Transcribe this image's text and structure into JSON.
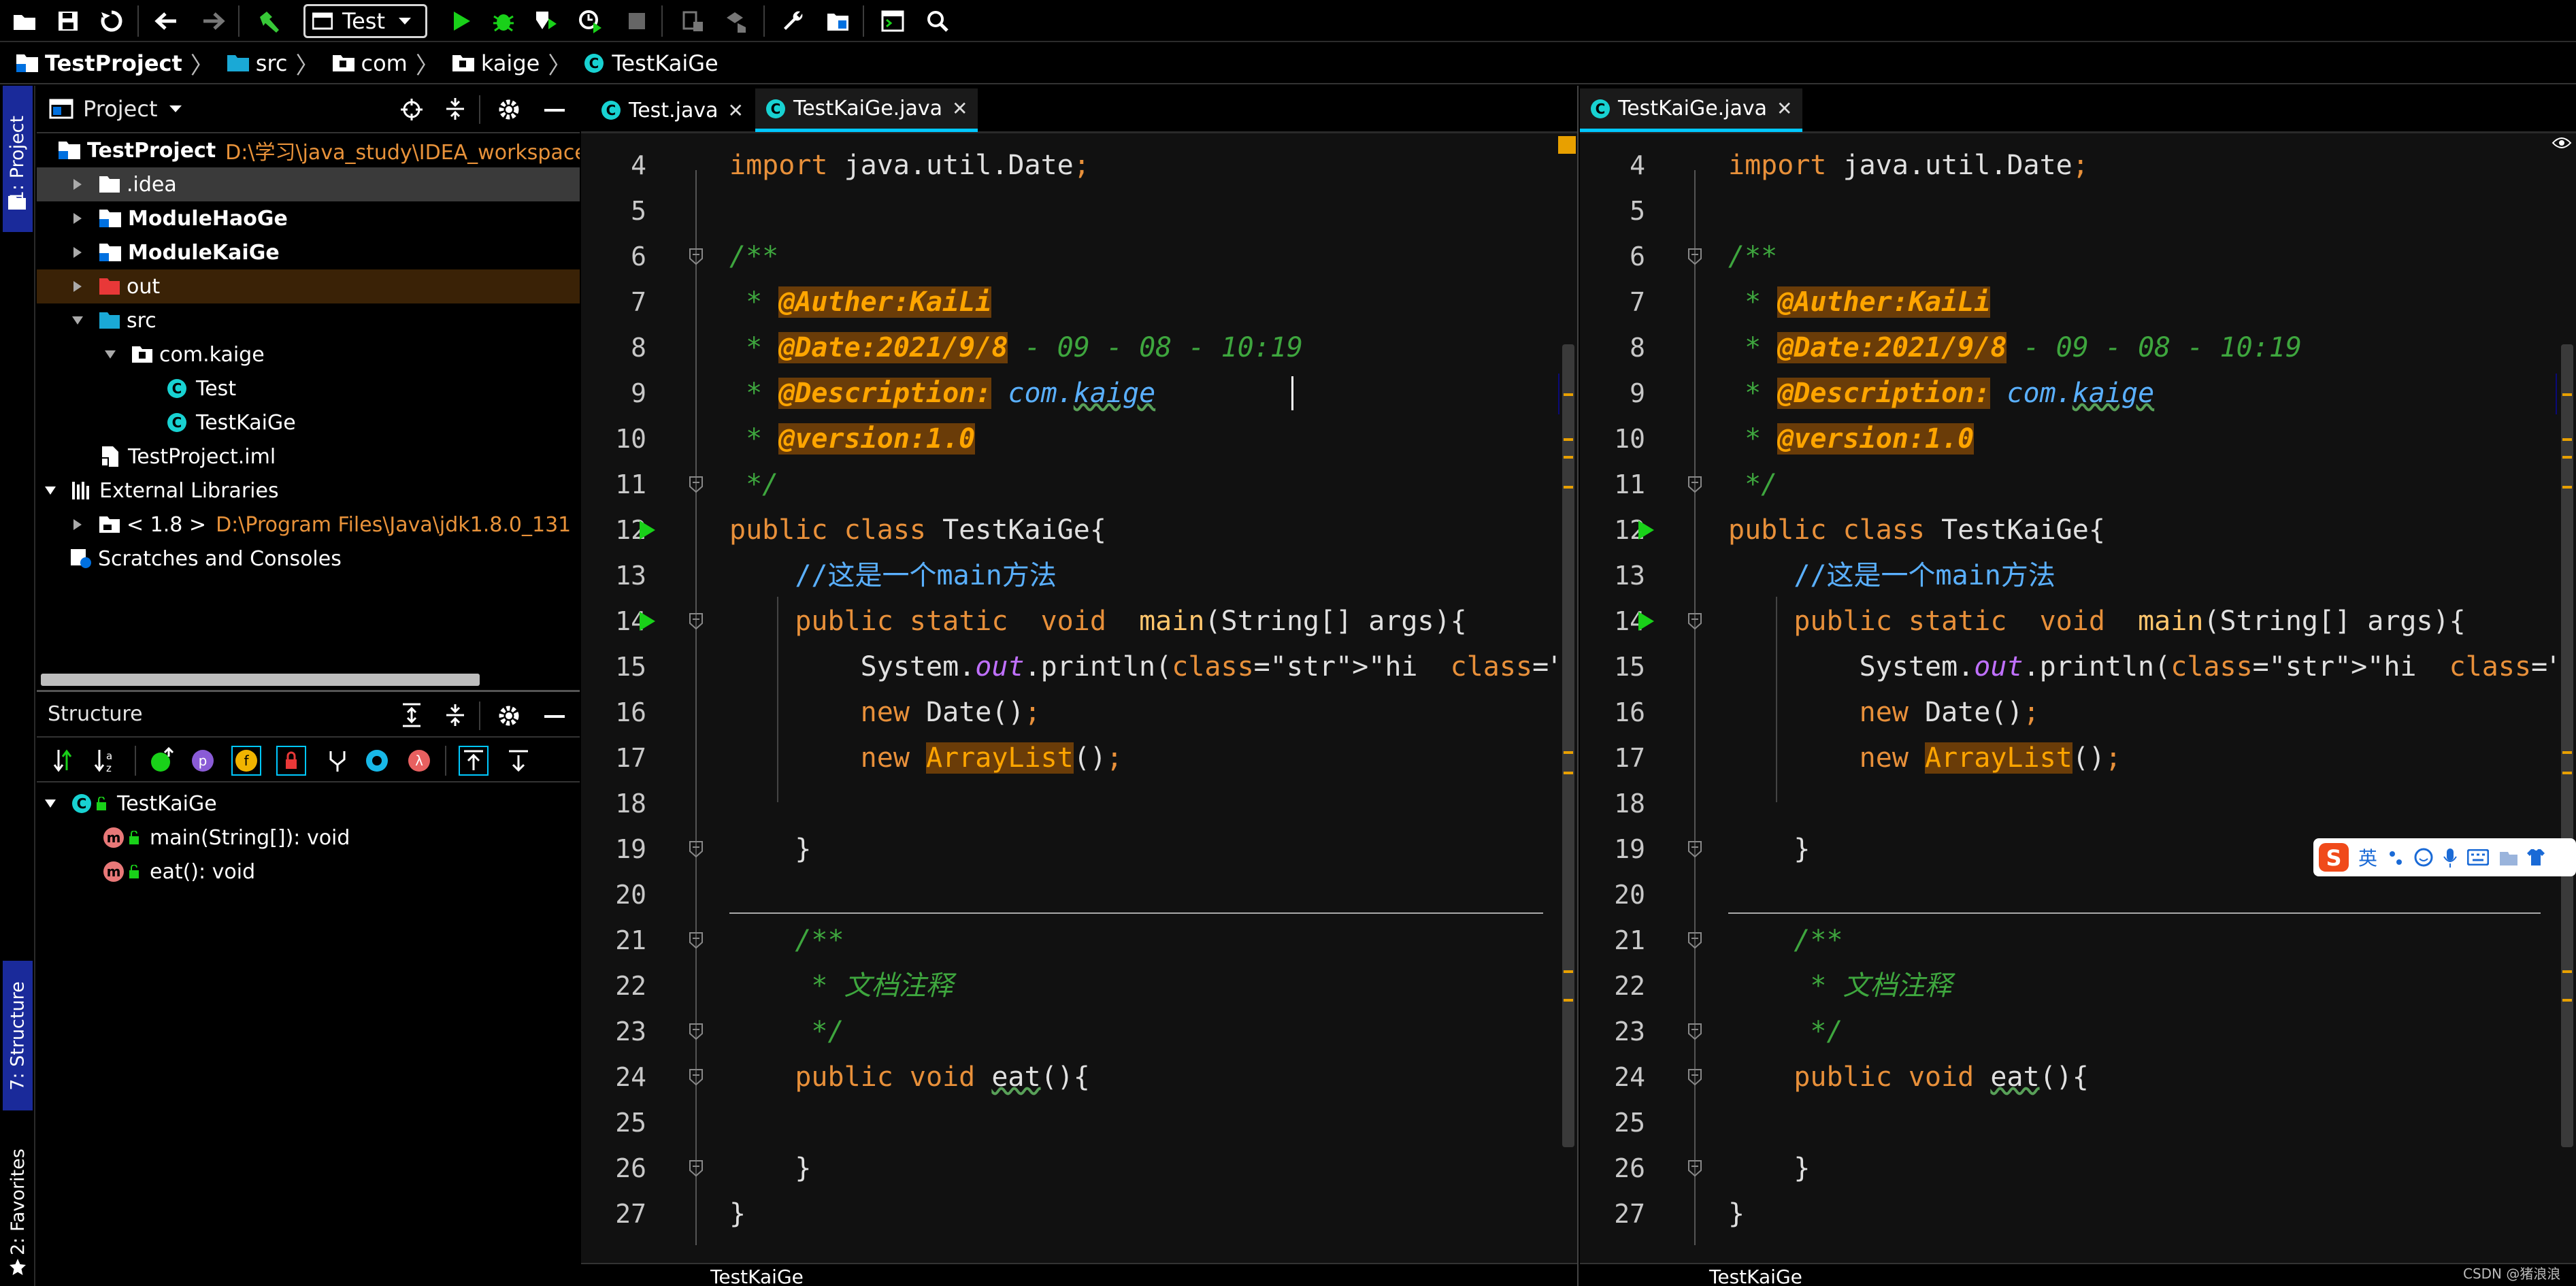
{
  "toolbar": {
    "run_config": "Test",
    "icons": [
      "open-folder-icon",
      "save-icon",
      "sync-icon",
      "back-icon",
      "forward-icon",
      "build-hammer-icon",
      "run-icon",
      "debug-icon",
      "coverage-icon",
      "profile-icon",
      "stop-icon",
      "deploy-icon",
      "deploy-all-icon",
      "settings-wrench-icon",
      "project-structure-icon",
      "terminal-icon",
      "search-icon"
    ]
  },
  "breadcrumb": [
    "TestProject",
    "src",
    "com",
    "kaige",
    "TestKaiGe"
  ],
  "stripe": {
    "project_tab": "1: Project",
    "structure_tab": "7: Structure",
    "favorites_tab": "2: Favorites"
  },
  "project_panel": {
    "title": "Project",
    "tree": [
      {
        "label": "TestProject",
        "path": "D:\\学习\\java_study\\IDEA_workspace\\",
        "bold": true
      },
      {
        "label": ".idea"
      },
      {
        "label": "ModuleHaoGe",
        "bold": true
      },
      {
        "label": "ModuleKaiGe",
        "bold": true
      },
      {
        "label": "out"
      },
      {
        "label": "src"
      },
      {
        "label": "com.kaige"
      },
      {
        "label": "Test"
      },
      {
        "label": "TestKaiGe"
      },
      {
        "label": "TestProject.iml"
      },
      {
        "label": "External Libraries"
      },
      {
        "label": "< 1.8 >",
        "path": "D:\\Program Files\\Java\\jdk1.8.0_131"
      },
      {
        "label": "Scratches and Consoles"
      }
    ]
  },
  "structure_panel": {
    "title": "Structure",
    "root": "TestKaiGe",
    "members": [
      "main(String[]): void",
      "eat(): void"
    ],
    "toolbar_badges": [
      "p",
      "f",
      "λ"
    ]
  },
  "editor_left": {
    "tabs": [
      {
        "label": "Test.java",
        "active": false
      },
      {
        "label": "TestKaiGe.java",
        "active": true
      }
    ],
    "status": "TestKaiGe"
  },
  "editor_right": {
    "tabs": [
      {
        "label": "TestKaiGe.java",
        "active": true
      }
    ],
    "status": "TestKaiGe"
  },
  "code": {
    "line_numbers": [
      "4",
      "5",
      "6",
      "7",
      "8",
      "9",
      "10",
      "11",
      "12",
      "13",
      "14",
      "15",
      "16",
      "17",
      "18",
      "19",
      "20",
      "21",
      "22",
      "23",
      "24",
      "25",
      "26",
      "27"
    ],
    "lines": [
      "import java.util.Date;",
      "",
      "/**",
      " * @Auther:KaiLi",
      " * @Date:2021/9/8 - 09 - 08 - 10:19",
      " * @Description: com.kaige",
      " * @version:1.0",
      " */",
      "public class TestKaiGe{",
      "    //这是一个main方法",
      "    public static  void  main(String[] args){",
      "        System.out.println(\"hi  kaige\");",
      "        new Date();",
      "        new ArrayList();",
      "",
      "    }",
      "",
      "    /**",
      "     * 文档注释",
      "     */",
      "    public void eat(){",
      "",
      "    }",
      "}"
    ],
    "current_line": "9"
  },
  "ime": {
    "label": "英"
  },
  "watermark": "CSDN @猪浪浪",
  "colors": {
    "keyword": "#e8903a",
    "comment": "#3ea63e",
    "string": "#59c05b",
    "doc_tag_bg": "#6a3c08",
    "current_line": "#0a0a78",
    "tab_underline": "#00c8ff"
  }
}
